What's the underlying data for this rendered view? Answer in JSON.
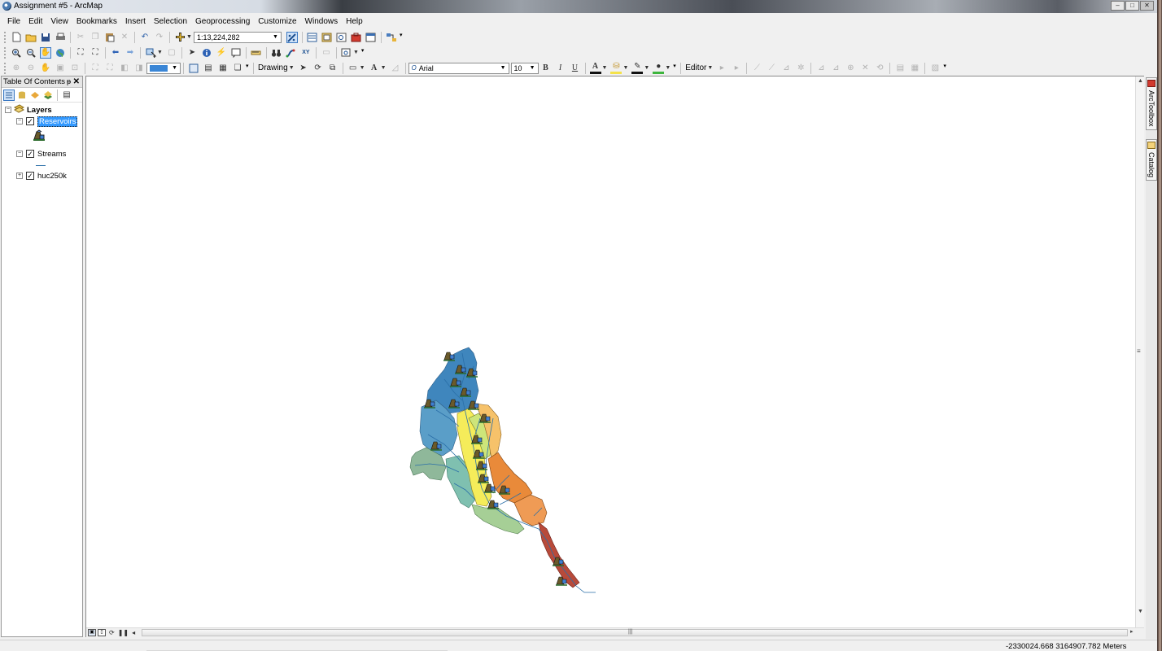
{
  "window": {
    "title": "Assignment #5 - ArcMap",
    "buttons": [
      "–",
      "□",
      "✕"
    ]
  },
  "menu": [
    "File",
    "Edit",
    "View",
    "Bookmarks",
    "Insert",
    "Selection",
    "Geoprocessing",
    "Customize",
    "Windows",
    "Help"
  ],
  "standard_toolbar": {
    "scale": "1:13,224,282"
  },
  "draw_toolbar": {
    "drawing_label": "Drawing",
    "font": "Arial",
    "font_size": "10",
    "bold": "B",
    "italic": "I",
    "underline": "U",
    "text_color_glyph": "A",
    "editor_label": "Editor"
  },
  "toc": {
    "title": "Table Of Contents",
    "pin": "ᵽ",
    "close": "✕",
    "root": "Layers",
    "layers": [
      {
        "name": "Reservoirs",
        "checked": true,
        "expanded": true,
        "selected": true
      },
      {
        "name": "Streams",
        "checked": true,
        "expanded": true,
        "selected": false
      },
      {
        "name": "huc250k",
        "checked": true,
        "expanded": false,
        "selected": false
      }
    ],
    "expand_minus": "−",
    "expand_plus": "+",
    "check_mark": "✓"
  },
  "dock": {
    "arctoolbox": "ArcToolbox",
    "catalog": "Catalog"
  },
  "status": {
    "coordinates": "-2330024.668  3164907.782 Meters"
  },
  "colors": {
    "selection": "#3399ff",
    "stream": "#2a6fa8",
    "watershed_blue": "#3f86bd",
    "watershed_yellow": "#f5ec5a",
    "watershed_orange": "#e98a3a",
    "watershed_red": "#b84a3a",
    "watershed_green": "#8fb89a"
  }
}
